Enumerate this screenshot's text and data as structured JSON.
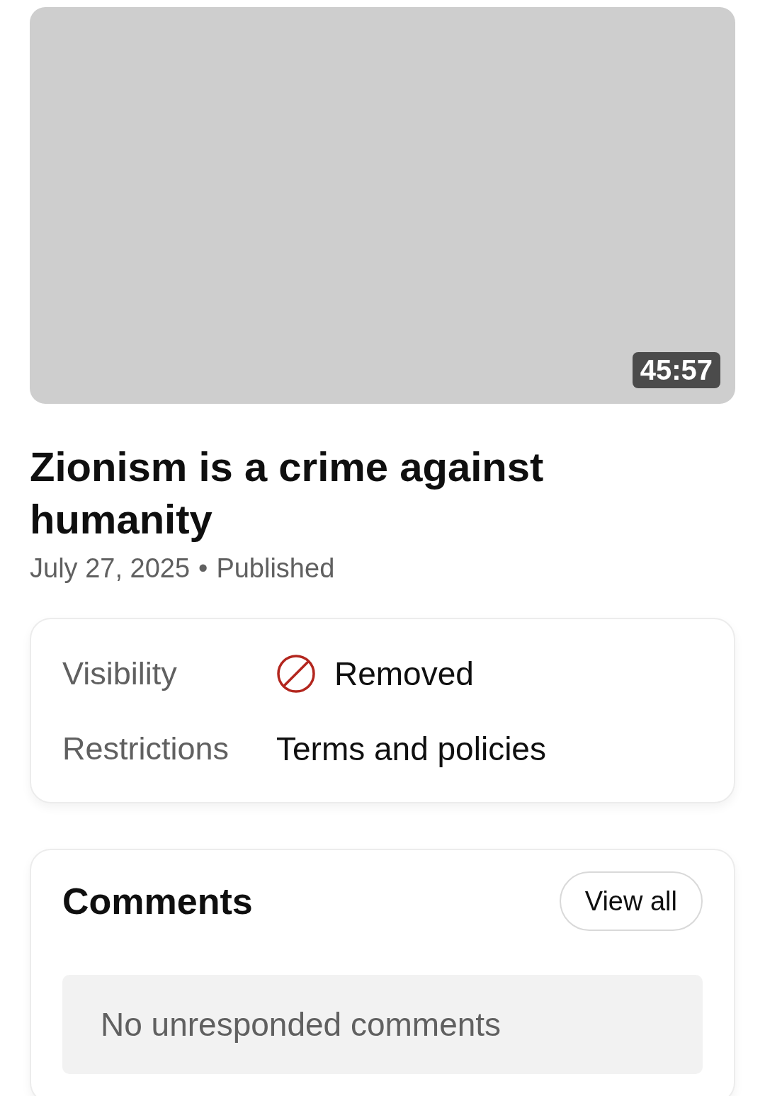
{
  "video": {
    "duration": "45:57"
  },
  "title": "Zionism is a crime against humanity",
  "meta": {
    "date": "July 27, 2025",
    "separator": "•",
    "status": "Published"
  },
  "details": [
    {
      "label": "Visibility",
      "value": "Removed",
      "kind": "removed"
    },
    {
      "label": "Restrictions",
      "value": "Terms and policies",
      "kind": "text"
    }
  ],
  "comments": {
    "heading": "Comments",
    "button": "View all",
    "empty": "No unresponded comments"
  }
}
